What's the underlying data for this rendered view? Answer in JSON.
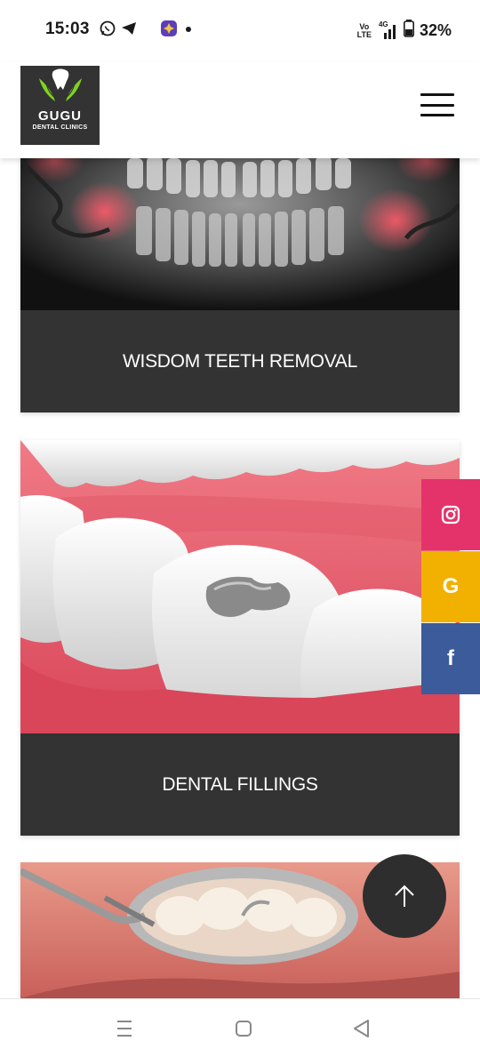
{
  "status_bar": {
    "time": "15:03",
    "network": "4G",
    "volte_top": "Vo",
    "volte_bottom": "LTE",
    "battery": "32%",
    "left_icons": [
      "whatsapp-icon",
      "telegram-icon",
      "app-icon",
      "dot-icon"
    ]
  },
  "header": {
    "logo_name": "GUGU",
    "logo_sub": "DENTAL CLINICS",
    "menu_icon": "hamburger-icon"
  },
  "services": [
    {
      "title": "WISDOM TEETH REMOVAL"
    },
    {
      "title": "DENTAL FILLINGS"
    }
  ],
  "social": [
    {
      "name": "instagram",
      "icon": "instagram-icon",
      "color": "#e4336b"
    },
    {
      "name": "google",
      "label": "G",
      "icon": "google-icon",
      "color": "#f2b100"
    },
    {
      "name": "facebook",
      "label": "f",
      "icon": "facebook-icon",
      "color": "#3b5b9a"
    }
  ],
  "back_to_top_icon": "arrow-up-icon",
  "nav": [
    "recents-icon",
    "home-icon",
    "back-icon"
  ],
  "colors": {
    "caption_bg": "#333333",
    "logo_green": "#7ed321",
    "gum_pink": "#e8566b"
  }
}
